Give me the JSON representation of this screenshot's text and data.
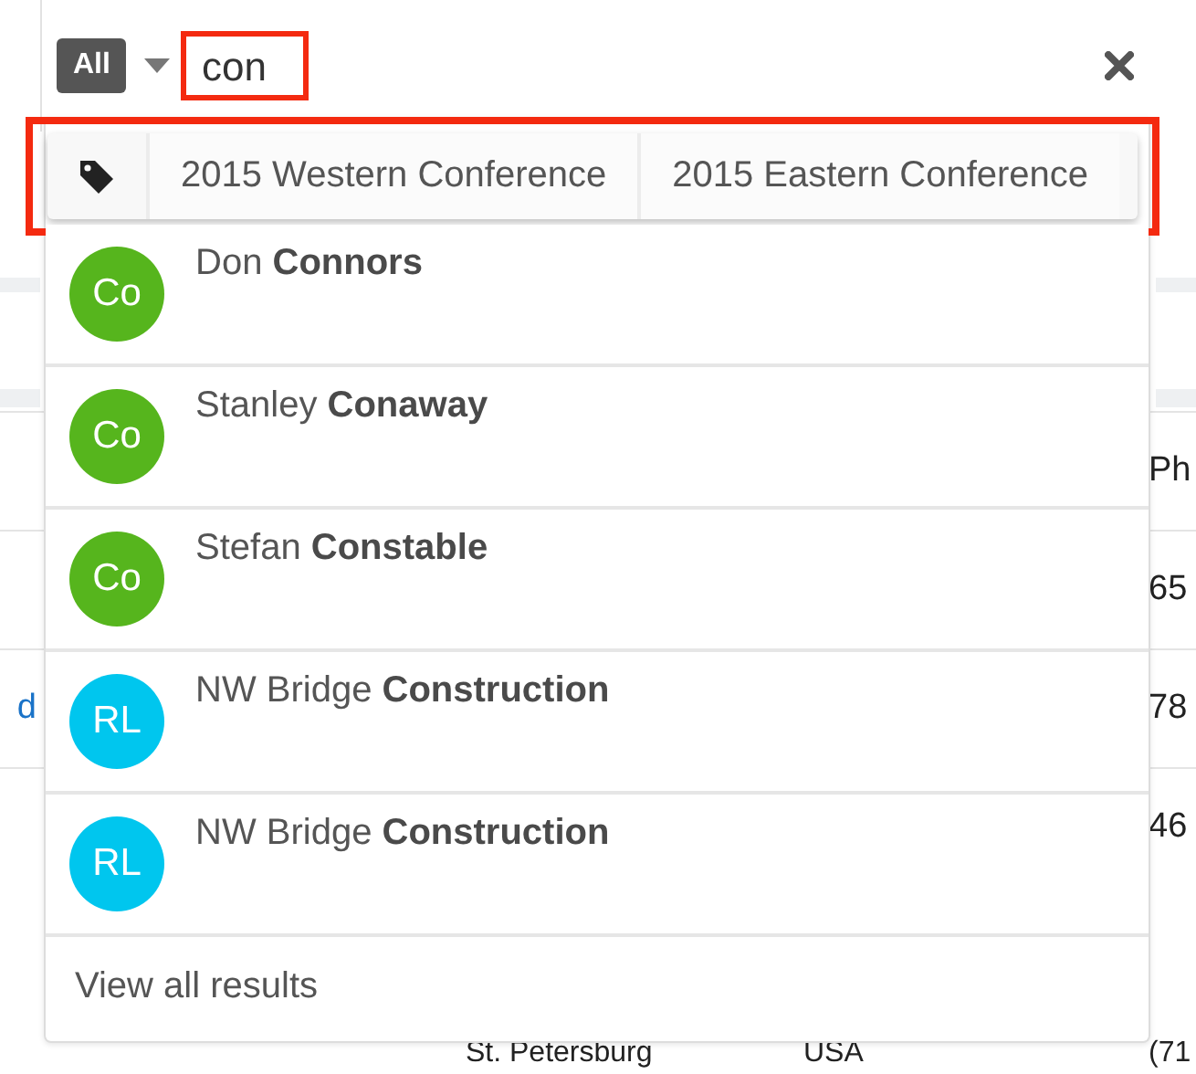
{
  "search": {
    "module_button": "All",
    "query": "con",
    "highlighted": true
  },
  "tags": {
    "highlighted": true,
    "items": [
      {
        "label": "2015 Western Conference"
      },
      {
        "label": "2015 Eastern Conference"
      }
    ]
  },
  "results": [
    {
      "initials": "Co",
      "color": "#56b51d",
      "name": "Don **Connors**"
    },
    {
      "initials": "Co",
      "color": "#56b51d",
      "name": "Stanley **Conaway**"
    },
    {
      "initials": "Co",
      "color": "#56b51d",
      "name": "Stefan **Constable**"
    },
    {
      "initials": "RL",
      "color": "#00c6ee",
      "name": "NW Bridge **Construction**"
    },
    {
      "initials": "RL",
      "color": "#00c6ee",
      "name": "NW Bridge **Construction**"
    }
  ],
  "footer": "View all results",
  "table_behind": {
    "rows": [
      {
        "column_4": "Ph"
      },
      {
        "column_4": "65"
      },
      {
        "column_1": "d",
        "column_4": "78"
      },
      {
        "column_4": "46"
      },
      {
        "column_2": "St. Petersburg",
        "column_3": "USA",
        "column_4": "(71"
      }
    ]
  }
}
